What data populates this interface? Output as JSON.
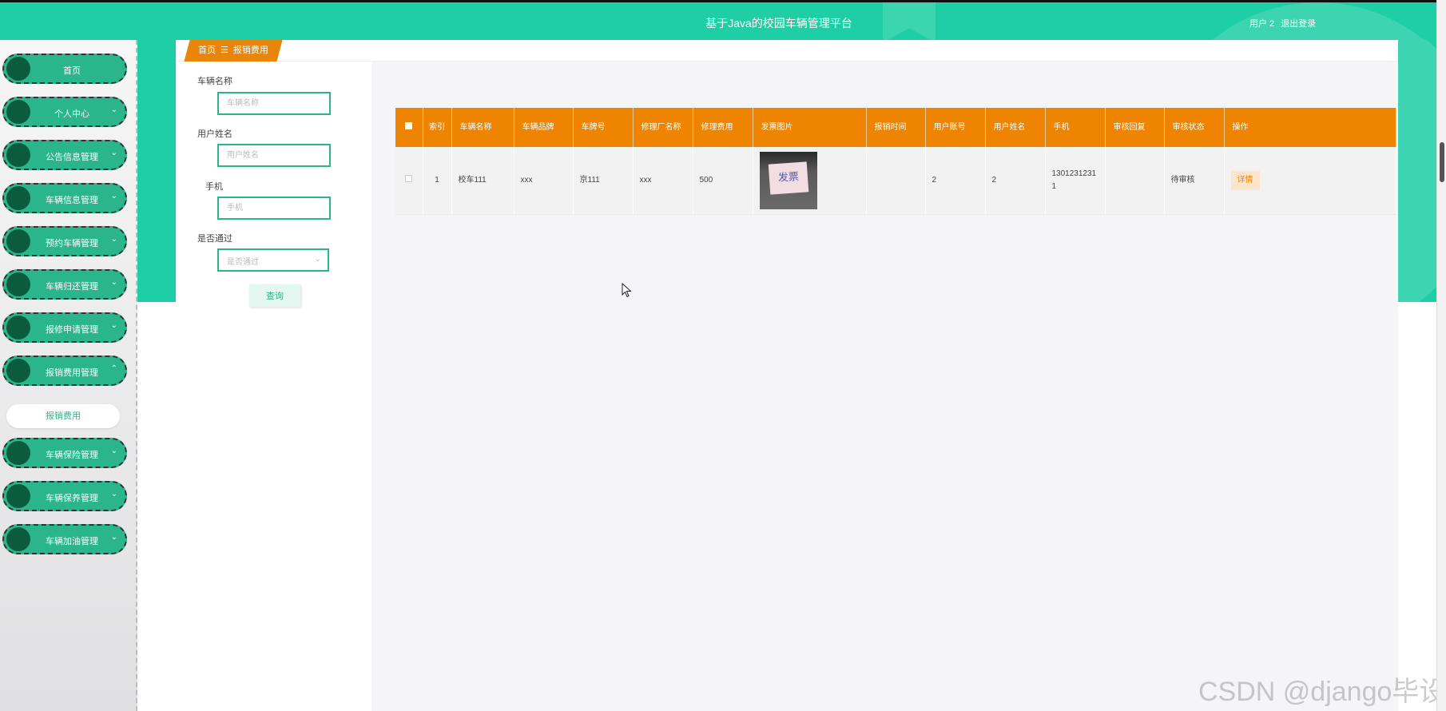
{
  "header": {
    "title": "基于Java的校园车辆管理平台",
    "user": "用户 2",
    "logout": "退出登录"
  },
  "sidebar": {
    "items": [
      {
        "label": "首页",
        "chevron": ""
      },
      {
        "label": "个人中心",
        "chevron": "⌄"
      },
      {
        "label": "公告信息管理",
        "chevron": "⌄"
      },
      {
        "label": "车辆信息管理",
        "chevron": "⌄"
      },
      {
        "label": "预约车辆管理",
        "chevron": "⌄"
      },
      {
        "label": "车辆归还管理",
        "chevron": "⌄"
      },
      {
        "label": "报修申请管理",
        "chevron": "⌄"
      },
      {
        "label": "报销费用管理",
        "chevron": "⌃"
      },
      {
        "label": "车辆保险管理",
        "chevron": "⌄"
      },
      {
        "label": "车辆保养管理",
        "chevron": "⌄"
      },
      {
        "label": "车辆加油管理",
        "chevron": "⌄"
      }
    ],
    "subitem": "报销费用"
  },
  "breadcrumb": {
    "home": "首页",
    "separator": "☰",
    "current": "报销费用"
  },
  "search": {
    "vehicle_name_label": "车辆名称",
    "vehicle_name_placeholder": "车辆名称",
    "user_name_label": "用户姓名",
    "user_name_placeholder": "用户姓名",
    "phone_label": "手机",
    "phone_placeholder": "手机",
    "passed_label": "是否通过",
    "passed_placeholder": "是否通过",
    "button": "查询"
  },
  "table": {
    "headers": [
      "索引",
      "车辆名称",
      "车辆品牌",
      "车牌号",
      "修理厂名称",
      "修理费用",
      "发票图片",
      "报销时间",
      "用户账号",
      "用户姓名",
      "手机",
      "审核回复",
      "审核状态",
      "操作"
    ],
    "rows": [
      {
        "index": "1",
        "vehicle_name": "校车111",
        "brand": "xxx",
        "plate": "京111",
        "garage": "xxx",
        "fee": "500",
        "invoice_text": "发票",
        "time": "",
        "account": "2",
        "user_name": "2",
        "phone": "13012312311",
        "reply": "",
        "status": "待审核",
        "action": "详情"
      }
    ]
  },
  "watermark": "CSDN @django毕设",
  "colors": {
    "accent": "#1ecfa5",
    "menu": "#2ab58a",
    "table_header": "#ee8400"
  }
}
